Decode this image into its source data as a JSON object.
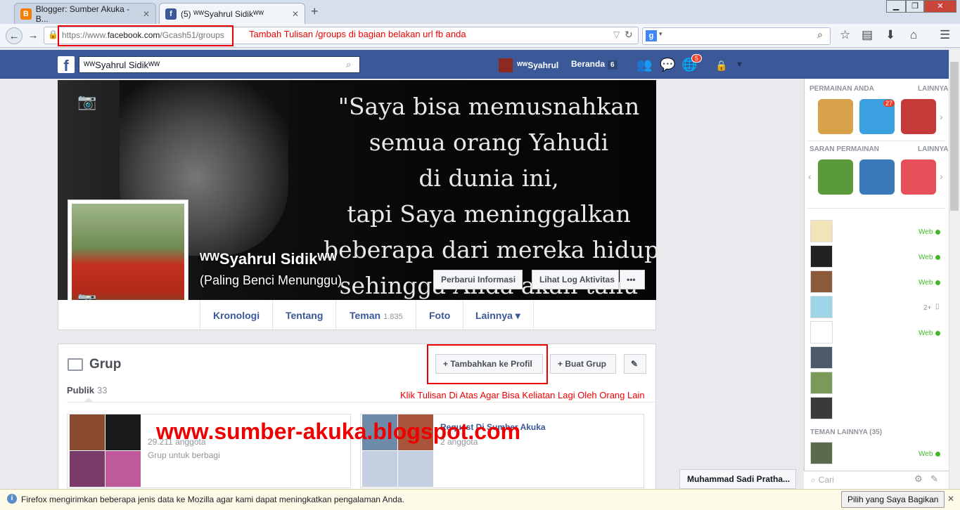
{
  "browser": {
    "tabs": [
      {
        "label": "Blogger: Sumber Akuka - B...",
        "favicon": "blogger-icon"
      },
      {
        "label": "(5) ᵂᵂSyahrul Sidikᵂᵂ",
        "favicon": "facebook-icon"
      }
    ],
    "url_prefix": "https://www.",
    "url_domain": "facebook.com",
    "url_path": "/Gcash51/groups",
    "url_annotation": "Tambah Tulisan /groups di bagian belakan url fb anda",
    "search_engine": "g"
  },
  "fb_header": {
    "search_value": "ᵂᵂSyahrul Sidikᵂᵂ",
    "profile_name": "ᵂᵂSyahrul",
    "home_label": "Beranda",
    "home_count": "6",
    "notif_count": "5"
  },
  "cover": {
    "quote": "\"Saya bisa memusnahkan\nsemua orang Yahudi\ndi dunia ini,\ntapi Saya meninggalkan\nbeberapa dari mereka hidup\nsehingga Anda akan tahu",
    "name": "ᵂᵂSyahrul Sidikᵂᵂ",
    "subtitle": "(Paling Benci Menunggu)",
    "btn_update": "Perbarui Informasi",
    "btn_log": "Lihat Log Aktivitas",
    "btn_more": "•••"
  },
  "profile_tabs": [
    {
      "label": "Kronologi",
      "count": ""
    },
    {
      "label": "Tentang",
      "count": ""
    },
    {
      "label": "Teman",
      "count": "1.835"
    },
    {
      "label": "Foto",
      "count": ""
    },
    {
      "label": "Lainnya ▾",
      "count": ""
    }
  ],
  "groups": {
    "title": "Grup",
    "btn_add": "+ Tambahkan ke Profil",
    "btn_create": "+ Buat Grup",
    "btn_edit": "✎",
    "filter_label": "Publik",
    "filter_count": "33",
    "annotation": "Klik Tulisan Di Atas Agar Bisa Keliatan Lagi Oleh Orang Lain",
    "watermark": "www.sumber-akuka.blogspot.com",
    "cards": [
      {
        "name": "",
        "members": "29.211 anggota",
        "desc": "Grup untuk berbagi"
      },
      {
        "name": "Request Di Sumber Akuka",
        "members": "2 anggota",
        "desc": ""
      }
    ]
  },
  "sidebar": {
    "games_header": "PERMAINAN ANDA",
    "games_more": "LAINNYA",
    "games_badge": "27",
    "suggest_header": "SARAN PERMAINAN",
    "suggest_more": "LAINNYA",
    "contact_status": [
      "Web",
      "Web",
      "Web",
      "2+",
      "Web",
      "",
      "",
      ""
    ],
    "other_friends": "TEMAN LAINNYA (35)",
    "last_status": "Web",
    "chat_search": "Cari"
  },
  "chat_tab": "Muhammad Sadi Pratha...",
  "notification": {
    "text": "Firefox mengirimkan beberapa jenis data ke Mozilla agar kami dapat meningkatkan pengalaman Anda.",
    "button": "Pilih yang Saya Bagikan"
  }
}
